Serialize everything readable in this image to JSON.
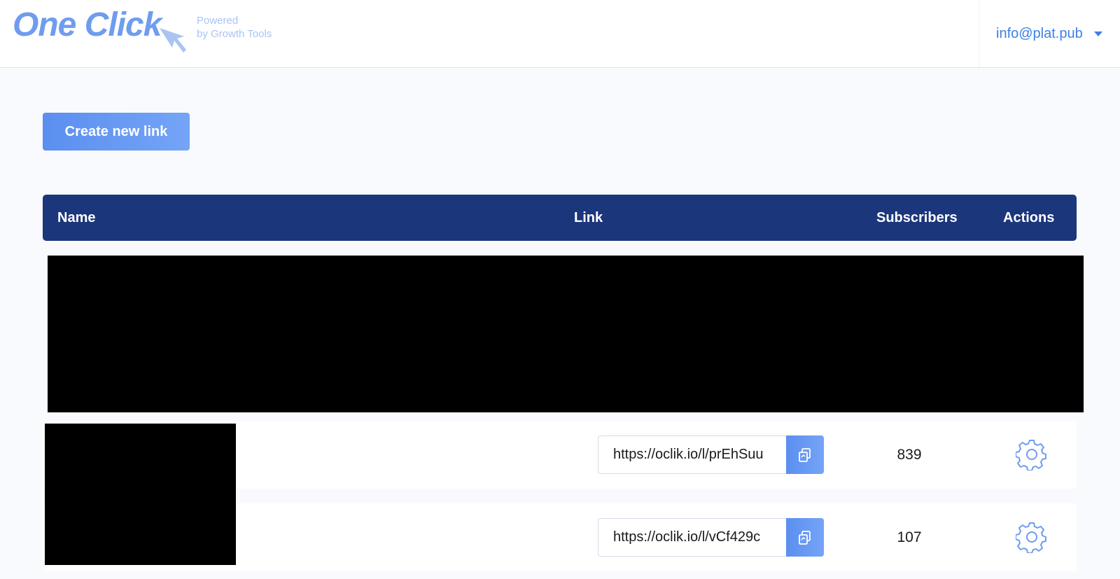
{
  "brand": {
    "name": "One Click",
    "tagline_line1": "Powered",
    "tagline_line2": "by Growth Tools",
    "color": "#6f9cee"
  },
  "account": {
    "email": "info@plat.pub"
  },
  "toolbar": {
    "create_label": "Create new link"
  },
  "table": {
    "headers": {
      "name": "Name",
      "link": "Link",
      "subscribers": "Subscribers",
      "actions": "Actions"
    },
    "header_color": "#1c367c",
    "rows": [
      {
        "link": "https://oclik.io/l/prEhSuu",
        "subscribers": "839",
        "copy_icon": "copy-icon",
        "settings_icon": "gear-icon"
      },
      {
        "link": "https://oclik.io/l/vCf429c",
        "subscribers": "107",
        "copy_icon": "copy-icon",
        "settings_icon": "gear-icon"
      }
    ]
  },
  "colors": {
    "accent": "#5b8ff0",
    "link_text": "#3d7ee6",
    "background": "#f8fafd"
  }
}
